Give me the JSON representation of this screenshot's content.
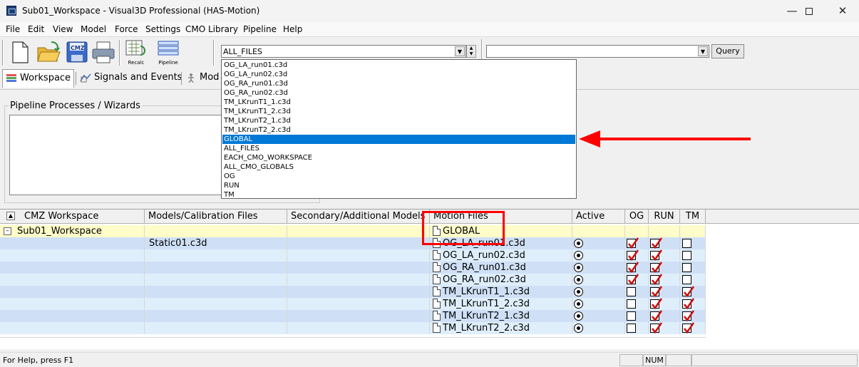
{
  "window": {
    "title": "Sub01_Workspace - Visual3D Professional (HAS-Motion)"
  },
  "menu": [
    "File",
    "Edit",
    "View",
    "Model",
    "Force",
    "Settings",
    "CMO Library",
    "Pipeline",
    "Help"
  ],
  "toolbar": {
    "recalc_label": "Recalc",
    "pipeline_label": "Pipeline",
    "cmz_label": "CMZ",
    "file_combo_value": "ALL_FILES",
    "query_combo_value": "",
    "query_button": "Query"
  },
  "tabs": [
    "Workspace",
    "Signals and Events",
    "Mod"
  ],
  "pipeline_panel": {
    "title": "Pipeline Processes / Wizards"
  },
  "dropdown": {
    "items": [
      "OG_LA_run01.c3d",
      "OG_LA_run02.c3d",
      "OG_RA_run01.c3d",
      "OG_RA_run02.c3d",
      "TM_LKrunT1_1.c3d",
      "TM_LKrunT1_2.c3d",
      "TM_LKrunT2_1.c3d",
      "TM_LKrunT2_2.c3d",
      "GLOBAL",
      "ALL_FILES",
      "EACH_CMO_WORKSPACE",
      "ALL_CMO_GLOBALS",
      "OG",
      "RUN",
      "TM"
    ],
    "selected_index": 8
  },
  "grid": {
    "headers": [
      "CMZ Workspace",
      "Models/Calibration Files",
      "Secondary/Additional Models",
      "Motion Files",
      "Active",
      "OG",
      "RUN",
      "TM"
    ],
    "workspace_name": "Sub01_Workspace",
    "global_file": "GLOBAL",
    "calibration_file": "Static01.c3d",
    "rows": [
      {
        "file": "OG_LA_run01.c3d",
        "og": true,
        "run": true,
        "tm": false
      },
      {
        "file": "OG_LA_run02.c3d",
        "og": true,
        "run": true,
        "tm": false
      },
      {
        "file": "OG_RA_run01.c3d",
        "og": true,
        "run": true,
        "tm": false
      },
      {
        "file": "OG_RA_run02.c3d",
        "og": true,
        "run": true,
        "tm": false
      },
      {
        "file": "TM_LKrunT1_1.c3d",
        "og": false,
        "run": true,
        "tm": true
      },
      {
        "file": "TM_LKrunT1_2.c3d",
        "og": false,
        "run": true,
        "tm": true
      },
      {
        "file": "TM_LKrunT2_1.c3d",
        "og": false,
        "run": true,
        "tm": true
      },
      {
        "file": "TM_LKrunT2_2.c3d",
        "og": false,
        "run": true,
        "tm": true
      }
    ]
  },
  "statusbar": {
    "help_text": "For Help, press F1",
    "num_indicator": "NUM"
  },
  "colors": {
    "selection": "#0078d7",
    "workspace_row": "#fefcc8",
    "row_light": "#dfeefb",
    "row_dark": "#cfe0f6",
    "annotation": "#ff0000",
    "check_mark": "#cc1111"
  }
}
